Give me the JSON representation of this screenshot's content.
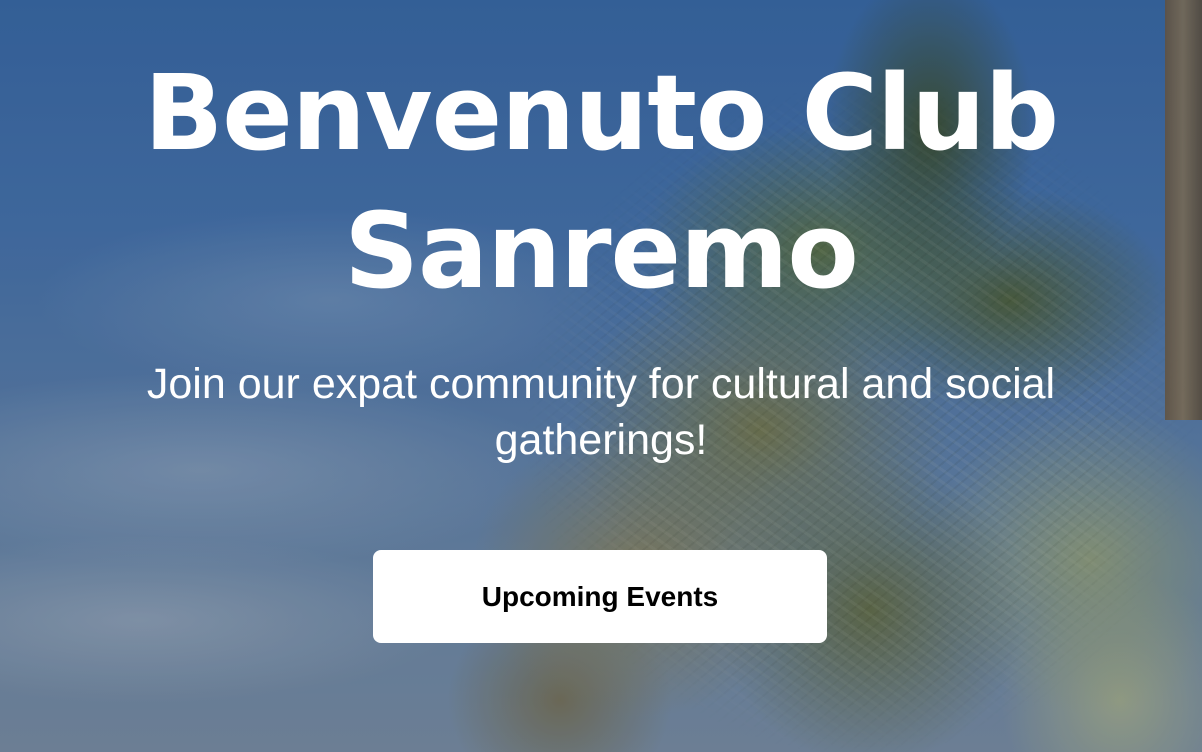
{
  "hero": {
    "title_line1": "Benvenuto Club",
    "title_line2": "Sanremo",
    "subtitle": "Join our expat community for cultural and social gatherings!",
    "cta_label": "Upcoming Events",
    "background": "palm-trees-sky-photo"
  },
  "colors": {
    "text": "#ffffff",
    "button_bg": "#ffffff",
    "button_text": "#000000",
    "sky": "#4673ab"
  }
}
